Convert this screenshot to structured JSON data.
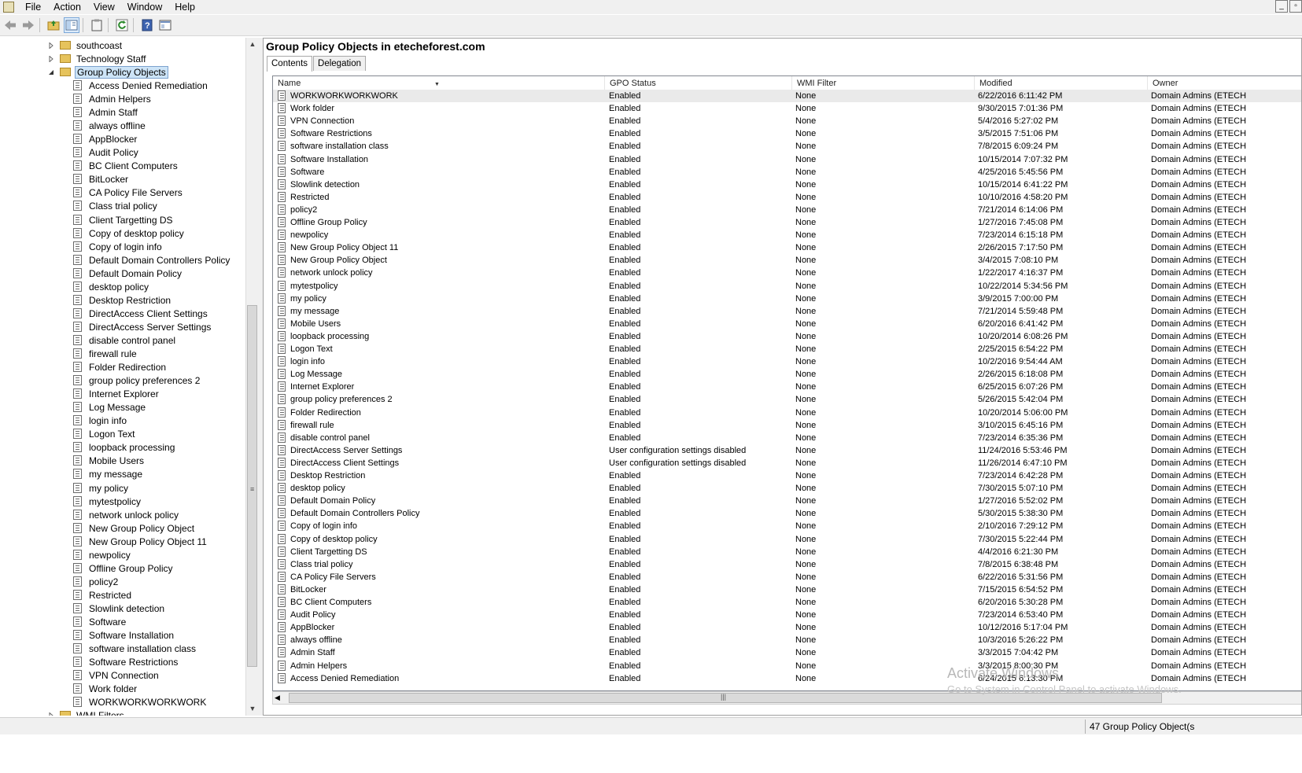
{
  "menu": [
    "File",
    "Action",
    "View",
    "Window",
    "Help"
  ],
  "tree": {
    "top_items": [
      "southcoast",
      "Technology Staff"
    ],
    "selected": "Group Policy Objects",
    "children": [
      "Access Denied Remediation",
      "Admin Helpers",
      "Admin Staff",
      "always offline",
      "AppBlocker",
      "Audit Policy",
      "BC Client Computers",
      "BitLocker",
      "CA Policy File Servers",
      "Class trial policy",
      "Client Targetting DS",
      "Copy of desktop policy",
      "Copy of login info",
      "Default Domain Controllers Policy",
      "Default Domain Policy",
      "desktop policy",
      "Desktop Restriction",
      "DirectAccess Client Settings",
      "DirectAccess Server Settings",
      "disable control panel",
      "firewall rule",
      "Folder Redirection",
      "group policy preferences 2",
      "Internet Explorer",
      "Log Message",
      "login info",
      "Logon Text",
      "loopback processing",
      "Mobile Users",
      "my message",
      "my policy",
      "mytestpolicy",
      "network unlock policy",
      "New Group Policy Object",
      "New Group Policy Object 11",
      "newpolicy",
      "Offline Group Policy",
      "policy2",
      "Restricted",
      "Slowlink detection",
      "Software",
      "Software Installation",
      "software installation class",
      "Software Restrictions",
      "VPN Connection",
      "Work folder",
      "WORKWORKWORKWORK"
    ],
    "after": "WMI Filters"
  },
  "pane": {
    "title": "Group Policy Objects in etecheforest.com",
    "tabs": [
      "Contents",
      "Delegation"
    ],
    "columns": [
      "Name",
      "GPO Status",
      "WMI Filter",
      "Modified",
      "Owner"
    ],
    "rows": [
      [
        "WORKWORKWORKWORK",
        "Enabled",
        "None",
        "6/22/2016 6:11:42 PM",
        "Domain Admins (ETECH"
      ],
      [
        "Work folder",
        "Enabled",
        "None",
        "9/30/2015 7:01:36 PM",
        "Domain Admins (ETECH"
      ],
      [
        "VPN Connection",
        "Enabled",
        "None",
        "5/4/2016 5:27:02 PM",
        "Domain Admins (ETECH"
      ],
      [
        "Software Restrictions",
        "Enabled",
        "None",
        "3/5/2015 7:51:06 PM",
        "Domain Admins (ETECH"
      ],
      [
        "software installation class",
        "Enabled",
        "None",
        "7/8/2015 6:09:24 PM",
        "Domain Admins (ETECH"
      ],
      [
        "Software Installation",
        "Enabled",
        "None",
        "10/15/2014 7:07:32 PM",
        "Domain Admins (ETECH"
      ],
      [
        "Software",
        "Enabled",
        "None",
        "4/25/2016 5:45:56 PM",
        "Domain Admins (ETECH"
      ],
      [
        "Slowlink detection",
        "Enabled",
        "None",
        "10/15/2014 6:41:22 PM",
        "Domain Admins (ETECH"
      ],
      [
        "Restricted",
        "Enabled",
        "None",
        "10/10/2016 4:58:20 PM",
        "Domain Admins (ETECH"
      ],
      [
        "policy2",
        "Enabled",
        "None",
        "7/21/2014 6:14:06 PM",
        "Domain Admins (ETECH"
      ],
      [
        "Offline Group Policy",
        "Enabled",
        "None",
        "1/27/2016 7:45:08 PM",
        "Domain Admins (ETECH"
      ],
      [
        "newpolicy",
        "Enabled",
        "None",
        "7/23/2014 6:15:18 PM",
        "Domain Admins (ETECH"
      ],
      [
        "New Group Policy Object 11",
        "Enabled",
        "None",
        "2/26/2015 7:17:50 PM",
        "Domain Admins (ETECH"
      ],
      [
        "New Group Policy Object",
        "Enabled",
        "None",
        "3/4/2015 7:08:10 PM",
        "Domain Admins (ETECH"
      ],
      [
        "network unlock policy",
        "Enabled",
        "None",
        "1/22/2017 4:16:37 PM",
        "Domain Admins (ETECH"
      ],
      [
        "mytestpolicy",
        "Enabled",
        "None",
        "10/22/2014 5:34:56 PM",
        "Domain Admins (ETECH"
      ],
      [
        "my policy",
        "Enabled",
        "None",
        "3/9/2015 7:00:00 PM",
        "Domain Admins (ETECH"
      ],
      [
        "my message",
        "Enabled",
        "None",
        "7/21/2014 5:59:48 PM",
        "Domain Admins (ETECH"
      ],
      [
        "Mobile Users",
        "Enabled",
        "None",
        "6/20/2016 6:41:42 PM",
        "Domain Admins (ETECH"
      ],
      [
        "loopback processing",
        "Enabled",
        "None",
        "10/20/2014 6:08:26 PM",
        "Domain Admins (ETECH"
      ],
      [
        "Logon Text",
        "Enabled",
        "None",
        "2/25/2015 6:54:22 PM",
        "Domain Admins (ETECH"
      ],
      [
        "login info",
        "Enabled",
        "None",
        "10/2/2016 9:54:44 AM",
        "Domain Admins (ETECH"
      ],
      [
        "Log Message",
        "Enabled",
        "None",
        "2/26/2015 6:18:08 PM",
        "Domain Admins (ETECH"
      ],
      [
        "Internet Explorer",
        "Enabled",
        "None",
        "6/25/2015 6:07:26 PM",
        "Domain Admins (ETECH"
      ],
      [
        "group policy preferences 2",
        "Enabled",
        "None",
        "5/26/2015 5:42:04 PM",
        "Domain Admins (ETECH"
      ],
      [
        "Folder Redirection",
        "Enabled",
        "None",
        "10/20/2014 5:06:00 PM",
        "Domain Admins (ETECH"
      ],
      [
        "firewall rule",
        "Enabled",
        "None",
        "3/10/2015 6:45:16 PM",
        "Domain Admins (ETECH"
      ],
      [
        "disable control panel",
        "Enabled",
        "None",
        "7/23/2014 6:35:36 PM",
        "Domain Admins (ETECH"
      ],
      [
        "DirectAccess Server Settings",
        "User configuration settings disabled",
        "None",
        "11/24/2016 5:53:46 PM",
        "Domain Admins (ETECH"
      ],
      [
        "DirectAccess Client Settings",
        "User configuration settings disabled",
        "None",
        "11/26/2014 6:47:10 PM",
        "Domain Admins (ETECH"
      ],
      [
        "Desktop Restriction",
        "Enabled",
        "None",
        "7/23/2014 6:42:28 PM",
        "Domain Admins (ETECH"
      ],
      [
        "desktop policy",
        "Enabled",
        "None",
        "7/30/2015 5:07:10 PM",
        "Domain Admins (ETECH"
      ],
      [
        "Default Domain Policy",
        "Enabled",
        "None",
        "1/27/2016 5:52:02 PM",
        "Domain Admins (ETECH"
      ],
      [
        "Default Domain Controllers Policy",
        "Enabled",
        "None",
        "5/30/2015 5:38:30 PM",
        "Domain Admins (ETECH"
      ],
      [
        "Copy of login info",
        "Enabled",
        "None",
        "2/10/2016 7:29:12 PM",
        "Domain Admins (ETECH"
      ],
      [
        "Copy of desktop policy",
        "Enabled",
        "None",
        "7/30/2015 5:22:44 PM",
        "Domain Admins (ETECH"
      ],
      [
        "Client Targetting DS",
        "Enabled",
        "None",
        "4/4/2016 6:21:30 PM",
        "Domain Admins (ETECH"
      ],
      [
        "Class trial policy",
        "Enabled",
        "None",
        "7/8/2015 6:38:48 PM",
        "Domain Admins (ETECH"
      ],
      [
        "CA Policy File Servers",
        "Enabled",
        "None",
        "6/22/2016 5:31:56 PM",
        "Domain Admins (ETECH"
      ],
      [
        "BitLocker",
        "Enabled",
        "None",
        "7/15/2015 6:54:52 PM",
        "Domain Admins (ETECH"
      ],
      [
        "BC Client Computers",
        "Enabled",
        "None",
        "6/20/2016 5:30:28 PM",
        "Domain Admins (ETECH"
      ],
      [
        "Audit Policy",
        "Enabled",
        "None",
        "7/23/2014 6:53:40 PM",
        "Domain Admins (ETECH"
      ],
      [
        "AppBlocker",
        "Enabled",
        "None",
        "10/12/2016 5:17:04 PM",
        "Domain Admins (ETECH"
      ],
      [
        "always offline",
        "Enabled",
        "None",
        "10/3/2016 5:26:22 PM",
        "Domain Admins (ETECH"
      ],
      [
        "Admin Staff",
        "Enabled",
        "None",
        "3/3/2015 7:04:42 PM",
        "Domain Admins (ETECH"
      ],
      [
        "Admin Helpers",
        "Enabled",
        "None",
        "3/3/2015 8:00:30 PM",
        "Domain Admins (ETECH"
      ],
      [
        "Access Denied Remediation",
        "Enabled",
        "None",
        "6/24/2015 6:13:30 PM",
        "Domain Admins (ETECH"
      ]
    ]
  },
  "watermark": {
    "line1": "Activate Windows",
    "line2": "Go to System in Control Panel to activate Windows."
  },
  "status": "47 Group Policy Object(s"
}
